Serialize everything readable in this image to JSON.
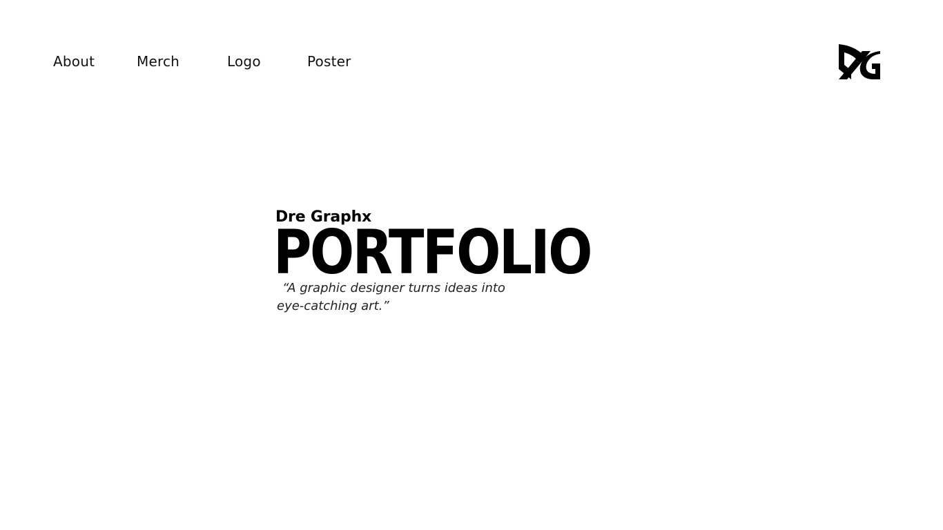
{
  "nav": {
    "items": [
      {
        "label": "About"
      },
      {
        "label": "Merch"
      },
      {
        "label": "Logo"
      },
      {
        "label": "Poster"
      }
    ]
  },
  "logo": {
    "icon": "dg-monogram-logo",
    "text": "DG"
  },
  "hero": {
    "brand": "Dre Graphx",
    "title": "PORTFOLIO",
    "quote_line_1": "“A graphic designer turns ideas into",
    "quote_line_2": "eye-catching art.”"
  },
  "colors": {
    "background": "#ffffff",
    "text": "#000000"
  }
}
